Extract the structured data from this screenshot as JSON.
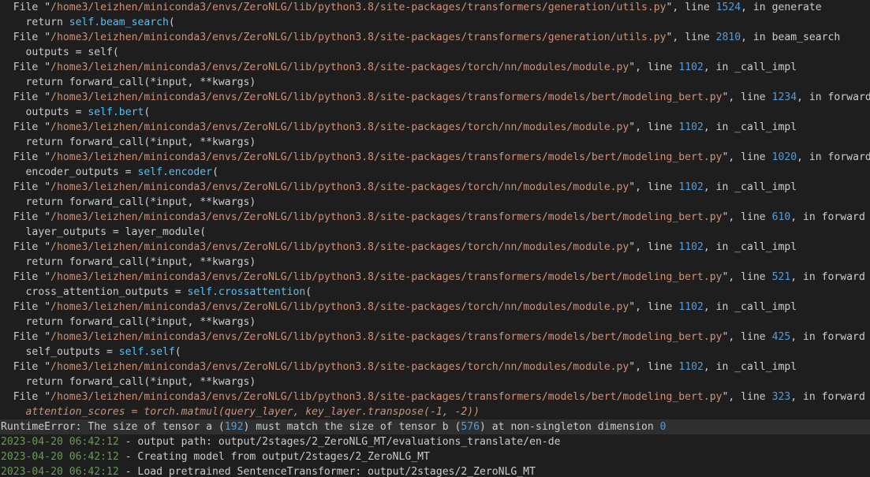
{
  "terminal": {
    "trace": [
      {
        "kind": "file",
        "path": "/home3/leizhen/miniconda3/envs/ZeroNLG/lib/python3.8/site-packages/transformers/generation/utils.py",
        "line": "1524",
        "func": "generate"
      },
      {
        "kind": "code",
        "pre": "return ",
        "attr": "self.beam_search",
        "post": "("
      },
      {
        "kind": "file",
        "path": "/home3/leizhen/miniconda3/envs/ZeroNLG/lib/python3.8/site-packages/transformers/generation/utils.py",
        "line": "2810",
        "func": "beam_search"
      },
      {
        "kind": "code",
        "pre": "outputs = self(",
        "attr": "",
        "post": ""
      },
      {
        "kind": "file",
        "path": "/home3/leizhen/miniconda3/envs/ZeroNLG/lib/python3.8/site-packages/torch/nn/modules/module.py",
        "line": "1102",
        "func": "_call_impl"
      },
      {
        "kind": "code",
        "pre": "return forward_call(*input, **kwargs)",
        "attr": "",
        "post": ""
      },
      {
        "kind": "file",
        "path": "/home3/leizhen/miniconda3/envs/ZeroNLG/lib/python3.8/site-packages/transformers/models/bert/modeling_bert.py",
        "line": "1234",
        "func": "forward"
      },
      {
        "kind": "code",
        "pre": "outputs = ",
        "attr": "self.bert",
        "post": "("
      },
      {
        "kind": "file",
        "path": "/home3/leizhen/miniconda3/envs/ZeroNLG/lib/python3.8/site-packages/torch/nn/modules/module.py",
        "line": "1102",
        "func": "_call_impl"
      },
      {
        "kind": "code",
        "pre": "return forward_call(*input, **kwargs)",
        "attr": "",
        "post": ""
      },
      {
        "kind": "file",
        "path": "/home3/leizhen/miniconda3/envs/ZeroNLG/lib/python3.8/site-packages/transformers/models/bert/modeling_bert.py",
        "line": "1020",
        "func": "forward"
      },
      {
        "kind": "code",
        "pre": "encoder_outputs = ",
        "attr": "self.encoder",
        "post": "("
      },
      {
        "kind": "file",
        "path": "/home3/leizhen/miniconda3/envs/ZeroNLG/lib/python3.8/site-packages/torch/nn/modules/module.py",
        "line": "1102",
        "func": "_call_impl"
      },
      {
        "kind": "code",
        "pre": "return forward_call(*input, **kwargs)",
        "attr": "",
        "post": ""
      },
      {
        "kind": "file",
        "path": "/home3/leizhen/miniconda3/envs/ZeroNLG/lib/python3.8/site-packages/transformers/models/bert/modeling_bert.py",
        "line": "610",
        "func": "forward"
      },
      {
        "kind": "code",
        "pre": "layer_outputs = layer_module(",
        "attr": "",
        "post": ""
      },
      {
        "kind": "file",
        "path": "/home3/leizhen/miniconda3/envs/ZeroNLG/lib/python3.8/site-packages/torch/nn/modules/module.py",
        "line": "1102",
        "func": "_call_impl"
      },
      {
        "kind": "code",
        "pre": "return forward_call(*input, **kwargs)",
        "attr": "",
        "post": ""
      },
      {
        "kind": "file",
        "path": "/home3/leizhen/miniconda3/envs/ZeroNLG/lib/python3.8/site-packages/transformers/models/bert/modeling_bert.py",
        "line": "521",
        "func": "forward"
      },
      {
        "kind": "code",
        "pre": "cross_attention_outputs = ",
        "attr": "self.crossattention",
        "post": "("
      },
      {
        "kind": "file",
        "path": "/home3/leizhen/miniconda3/envs/ZeroNLG/lib/python3.8/site-packages/torch/nn/modules/module.py",
        "line": "1102",
        "func": "_call_impl"
      },
      {
        "kind": "code",
        "pre": "return forward_call(*input, **kwargs)",
        "attr": "",
        "post": ""
      },
      {
        "kind": "file",
        "path": "/home3/leizhen/miniconda3/envs/ZeroNLG/lib/python3.8/site-packages/transformers/models/bert/modeling_bert.py",
        "line": "425",
        "func": "forward"
      },
      {
        "kind": "code",
        "pre": "self_outputs = ",
        "attr": "self.self",
        "post": "("
      },
      {
        "kind": "file",
        "path": "/home3/leizhen/miniconda3/envs/ZeroNLG/lib/python3.8/site-packages/torch/nn/modules/module.py",
        "line": "1102",
        "func": "_call_impl"
      },
      {
        "kind": "code",
        "pre": "return forward_call(*input, **kwargs)",
        "attr": "",
        "post": ""
      },
      {
        "kind": "file",
        "path": "/home3/leizhen/miniconda3/envs/ZeroNLG/lib/python3.8/site-packages/transformers/models/bert/modeling_bert.py",
        "line": "323",
        "func": "forward"
      },
      {
        "kind": "italic",
        "text": "attention_scores = torch.matmul(query_layer, key_layer.transpose(-1, -2))"
      }
    ],
    "error": {
      "p1": "RuntimeError: The size of tensor a (",
      "n1": "192",
      "p2": ") must match the size of tensor b (",
      "n2": "576",
      "p3": ") at non-singleton dimension ",
      "n3": "0"
    },
    "logs": [
      {
        "ts": "2023-04-20 06:42:12",
        "msg": " - output path: output/2stages/2_ZeroNLG_MT/evaluations_translate/en-de"
      },
      {
        "ts": "2023-04-20 06:42:12",
        "msg": " - Creating model from output/2stages/2_ZeroNLG_MT"
      },
      {
        "ts": "2023-04-20 06:42:12",
        "msg": " - Load pretrained SentenceTransformer: output/2stages/2_ZeroNLG_MT"
      }
    ],
    "labels": {
      "file_prefix": "File ",
      "line_word": ", line ",
      "in_word": ", in "
    },
    "colors": {
      "background": "#1e1e1e",
      "text": "#cccccc",
      "path": "#ce9178",
      "number": "#569cd6",
      "attribute": "#4fc1ff",
      "timestamp": "#6a9955"
    }
  }
}
